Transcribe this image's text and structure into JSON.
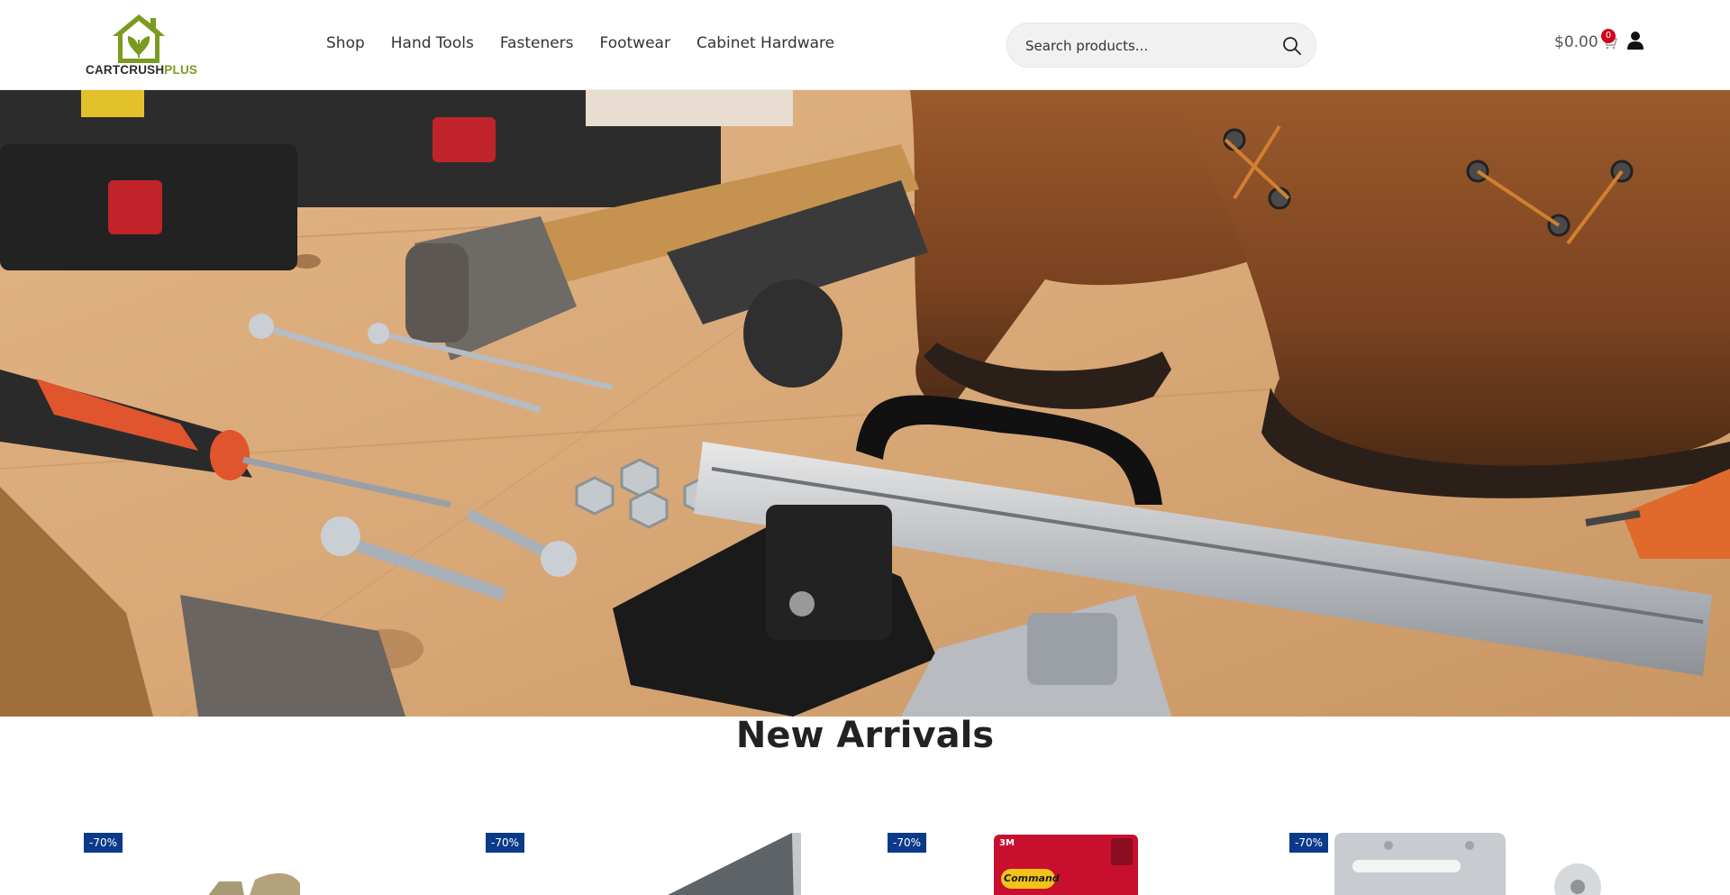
{
  "header": {
    "logo": {
      "part1": "CARTCRUSH",
      "part2": "PLUS"
    },
    "nav": [
      "Shop",
      "Hand Tools",
      "Fasteners",
      "Footwear",
      "Cabinet Hardware"
    ],
    "search": {
      "placeholder": "Search products...",
      "icon": "search-icon"
    },
    "cart": {
      "total": "$0.00",
      "count": "0",
      "icon": "cart-icon"
    },
    "account_icon": "user-icon"
  },
  "colors": {
    "brand_green": "#7a9b1f",
    "badge_blue": "#0b3a8a",
    "cart_badge_red": "#d0021b"
  },
  "sections": {
    "new_arrivals_title": "New Arrivals"
  },
  "products": [
    {
      "badge": "-70%"
    },
    {
      "badge": "-70%"
    },
    {
      "badge": "-70%",
      "brand_text": "Command",
      "brand_mark": "3M"
    },
    {
      "badge": "-70%"
    }
  ]
}
